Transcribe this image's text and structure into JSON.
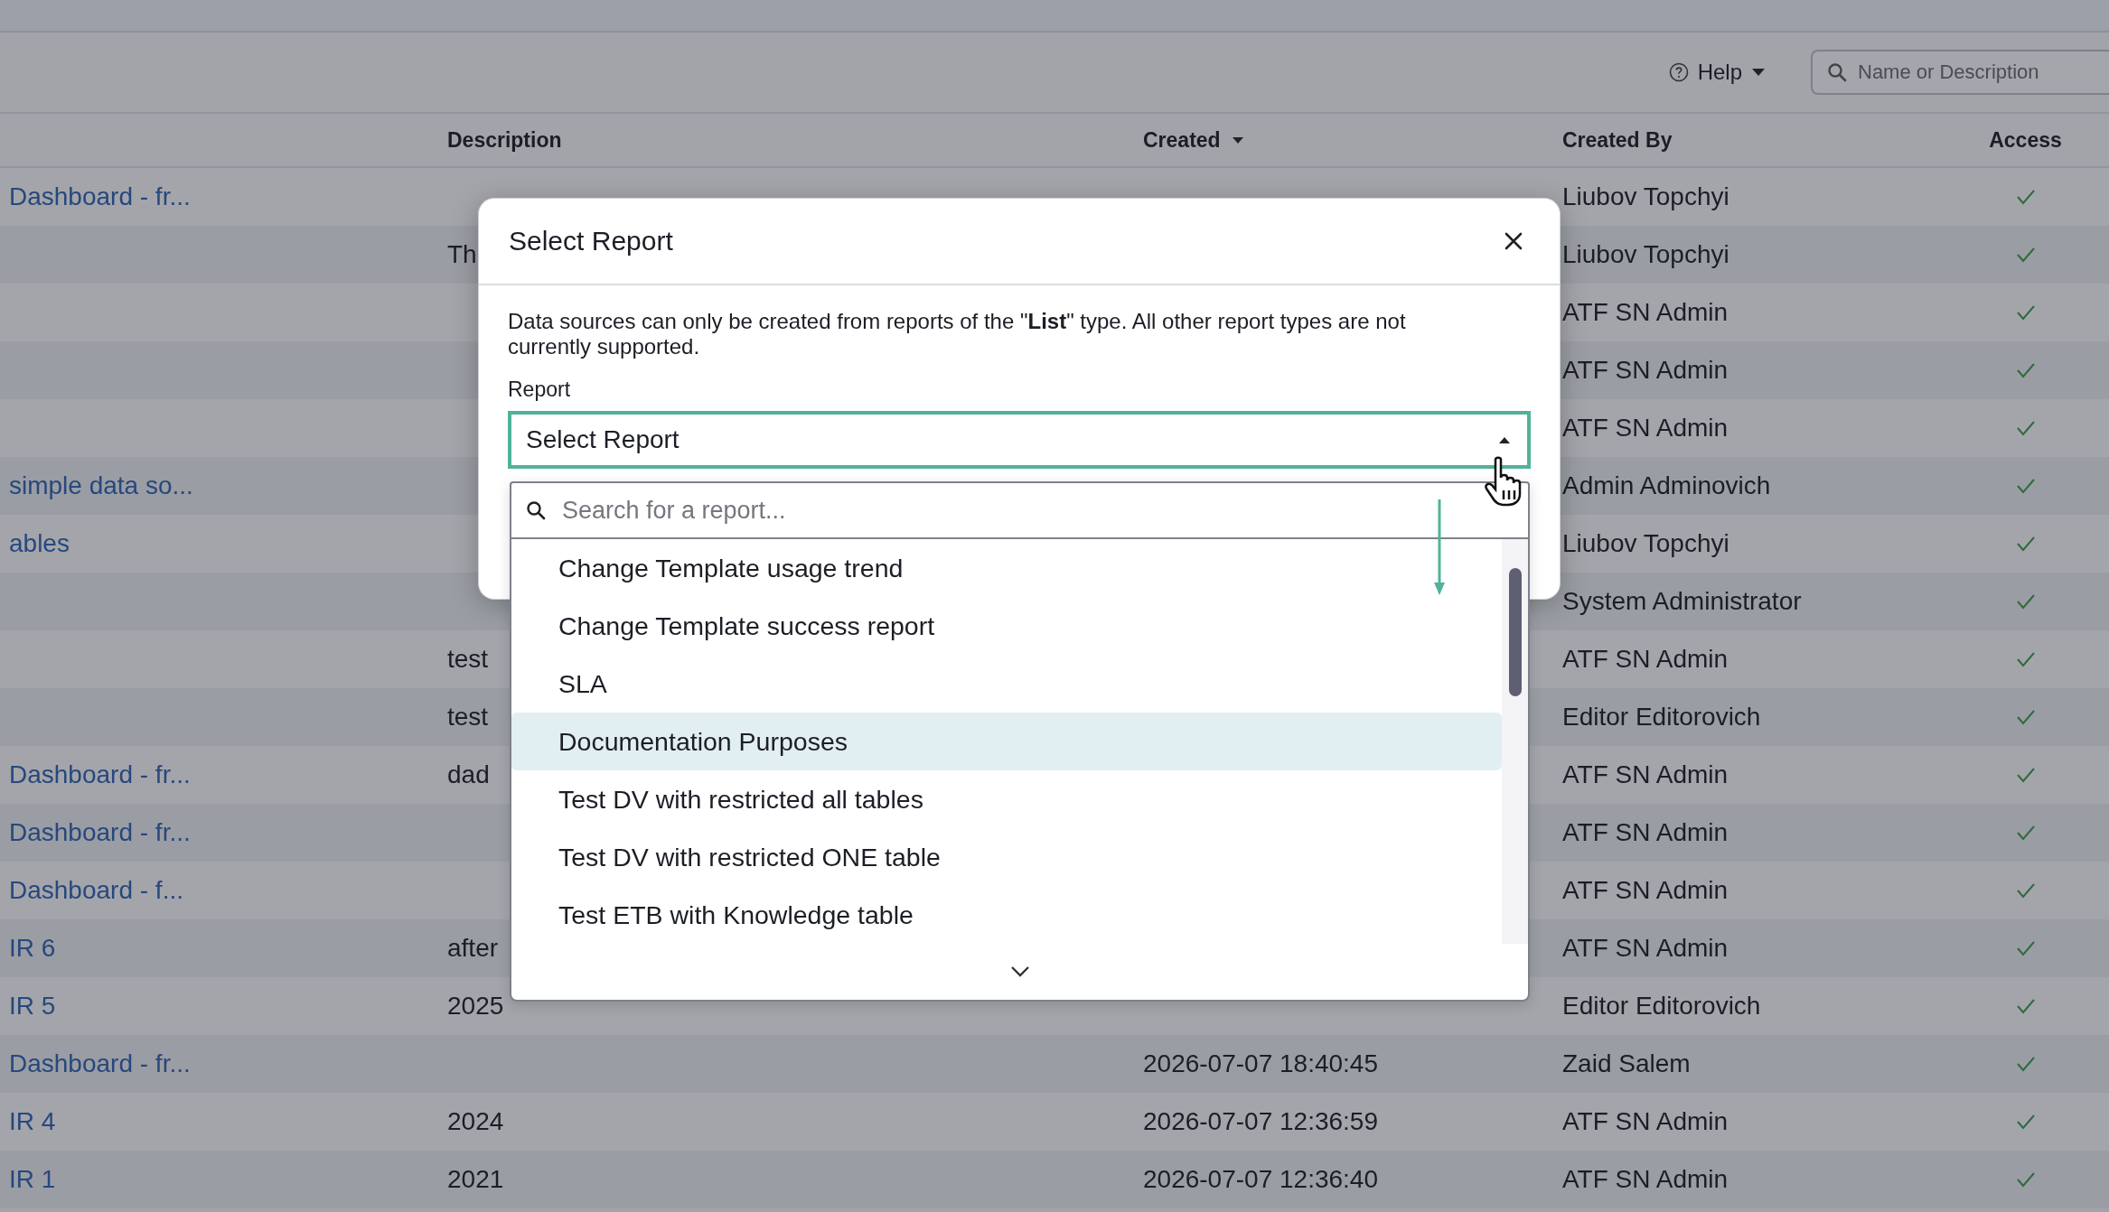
{
  "toolbar": {
    "help": "Help",
    "search": {
      "placeholder": "Name or Description"
    }
  },
  "table": {
    "columns": [
      {
        "label": "Description",
        "sorted": false
      },
      {
        "label": "Created",
        "sorted": true
      },
      {
        "label": "Created By",
        "sorted": false
      },
      {
        "label": "Access",
        "sorted": false
      }
    ],
    "rows": [
      {
        "name": "Dashboard - fr...",
        "created_by": "Liubov Topchyi",
        "access": true
      },
      {
        "description": "Th",
        "created_by": "Liubov Topchyi",
        "access": true
      },
      {
        "created_by": "ATF SN Admin",
        "access": true
      },
      {
        "created_by": "ATF SN Admin",
        "access": true
      },
      {
        "created_by": "ATF SN Admin",
        "access": true
      },
      {
        "name": "simple data so...",
        "created_by": "Admin Adminovich",
        "access": true
      },
      {
        "name": "ables",
        "created_by": "Liubov Topchyi",
        "access": true
      },
      {
        "created_by": "System Administrator",
        "access": true
      },
      {
        "description": "test",
        "created_by": "ATF SN Admin",
        "access": true
      },
      {
        "description": "test",
        "created_by": "Editor Editorovich",
        "access": true
      },
      {
        "name": "Dashboard - fr...",
        "description": "dad",
        "created_by": "ATF SN Admin",
        "access": true
      },
      {
        "name": "Dashboard - fr...",
        "created_by": "ATF SN Admin",
        "access": true
      },
      {
        "name": "Dashboard - f...",
        "created_by": "ATF SN Admin",
        "access": true
      },
      {
        "name": "IR 6",
        "description": "after",
        "created_by": "ATF SN Admin",
        "access": true
      },
      {
        "name": "IR 5",
        "description": "2025",
        "created_by": "Editor Editorovich",
        "access": true
      },
      {
        "name": "Dashboard - fr...",
        "created": "2026-07-07 18:40:45",
        "created_by": "Zaid Salem",
        "access": true
      },
      {
        "name": "IR 4",
        "description": "2024",
        "created": "2026-07-07 12:36:59",
        "created_by": "ATF SN Admin",
        "access": true
      },
      {
        "name": "IR 1",
        "description": "2021",
        "created": "2026-07-07 12:36:40",
        "created_by": "ATF SN Admin",
        "access": true
      }
    ]
  },
  "modal": {
    "title": "Select Report",
    "message": "Data sources can only be created from reports of the \"**List**\" type. All other report types are not currently supported.",
    "field_label": "Report",
    "select": {
      "value": "Select Report",
      "expanded": true
    },
    "dropdown": {
      "search": {
        "placeholder": "Search for a report..."
      },
      "options": [
        {
          "label": "Change Template usage trend",
          "highlighted": false
        },
        {
          "label": "Change Template success report",
          "highlighted": false
        },
        {
          "label": "SLA",
          "highlighted": false
        },
        {
          "label": "Documentation Purposes",
          "highlighted": true
        },
        {
          "label": "Test DV with restricted all tables",
          "highlighted": false
        },
        {
          "label": "Test DV with restricted ONE table",
          "highlighted": false
        },
        {
          "label": "Test ETB with Knowledge table",
          "highlighted": false
        }
      ]
    }
  }
}
